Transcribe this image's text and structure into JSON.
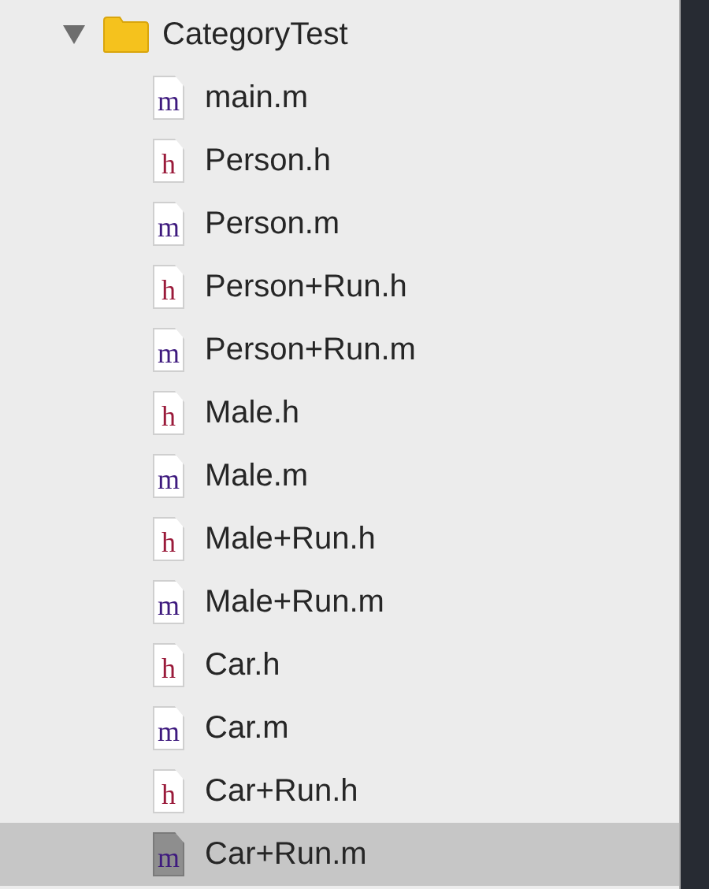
{
  "folder": {
    "name": "CategoryTest",
    "expanded": true,
    "children": [
      {
        "name": "main.m",
        "letter": "m",
        "kind": "impl",
        "selected": false
      },
      {
        "name": "Person.h",
        "letter": "h",
        "kind": "header",
        "selected": false
      },
      {
        "name": "Person.m",
        "letter": "m",
        "kind": "impl",
        "selected": false
      },
      {
        "name": "Person+Run.h",
        "letter": "h",
        "kind": "header",
        "selected": false
      },
      {
        "name": "Person+Run.m",
        "letter": "m",
        "kind": "impl",
        "selected": false
      },
      {
        "name": "Male.h",
        "letter": "h",
        "kind": "header",
        "selected": false
      },
      {
        "name": "Male.m",
        "letter": "m",
        "kind": "impl",
        "selected": false
      },
      {
        "name": "Male+Run.h",
        "letter": "h",
        "kind": "header",
        "selected": false
      },
      {
        "name": "Male+Run.m",
        "letter": "m",
        "kind": "impl",
        "selected": false
      },
      {
        "name": "Car.h",
        "letter": "h",
        "kind": "header",
        "selected": false
      },
      {
        "name": "Car.m",
        "letter": "m",
        "kind": "impl",
        "selected": false
      },
      {
        "name": "Car+Run.h",
        "letter": "h",
        "kind": "header",
        "selected": false
      },
      {
        "name": "Car+Run.m",
        "letter": "m",
        "kind": "impl",
        "selected": true
      }
    ]
  }
}
